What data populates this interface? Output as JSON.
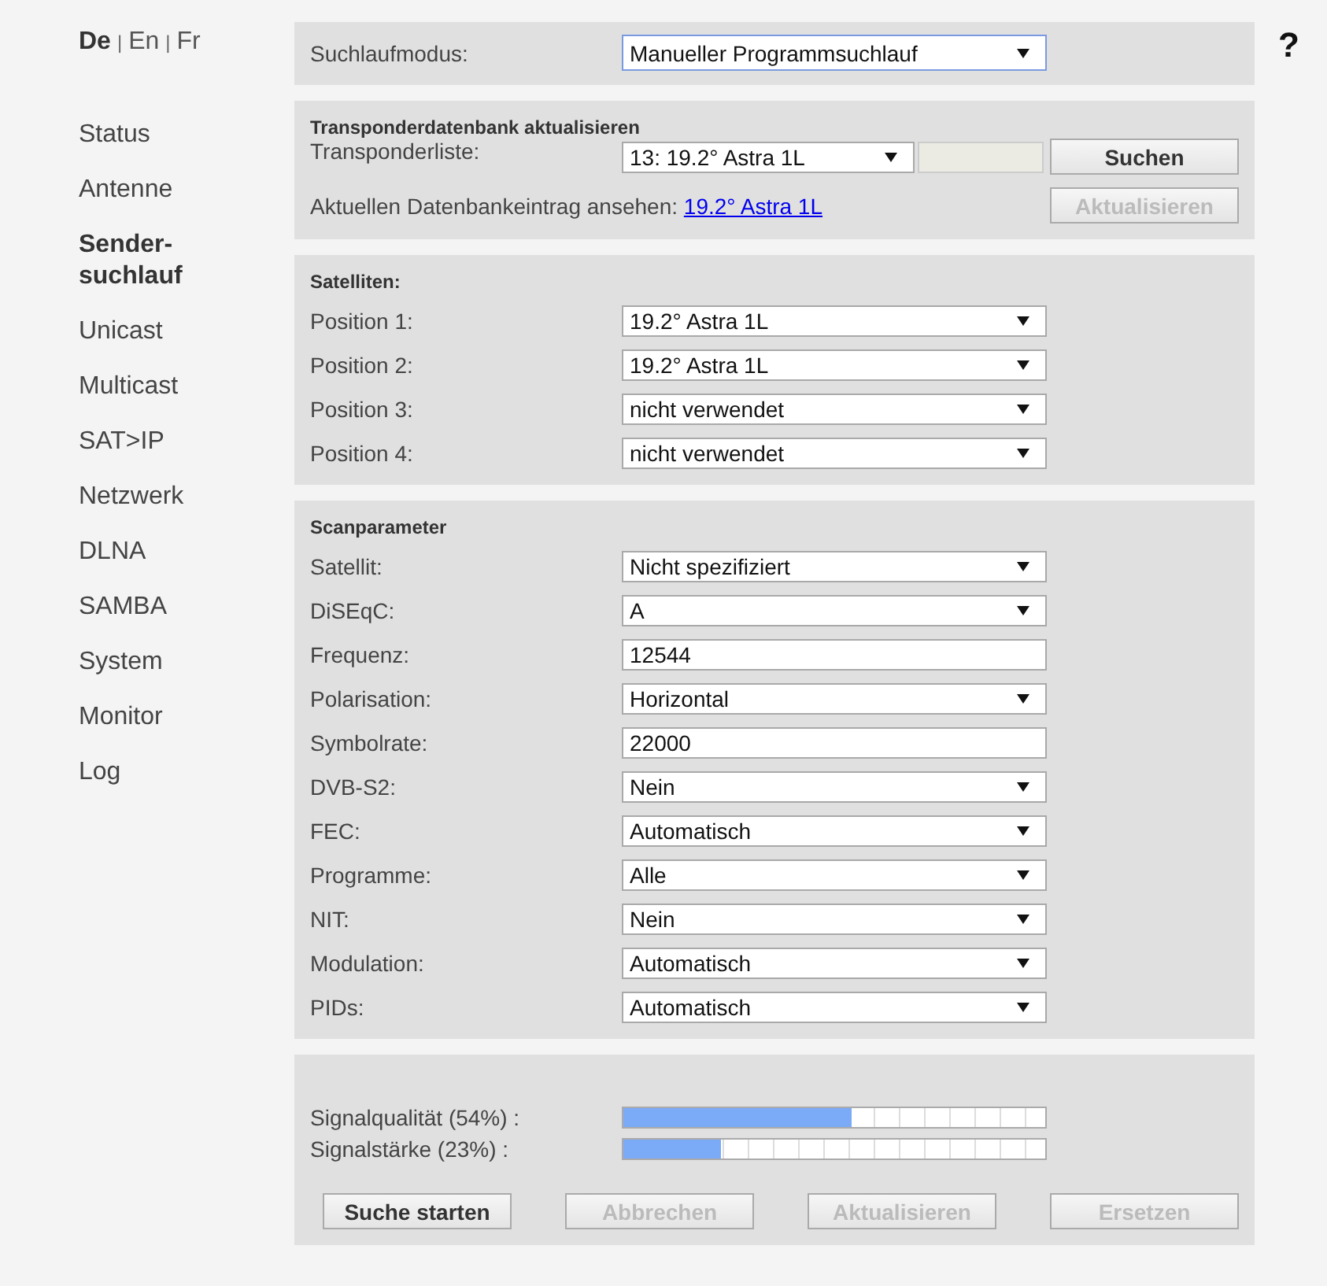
{
  "languages": [
    {
      "label": "De",
      "selected": true
    },
    {
      "label": "En",
      "selected": false
    },
    {
      "label": "Fr",
      "selected": false
    }
  ],
  "language_separator": "|",
  "help": "?",
  "sidebar": {
    "items": [
      {
        "label": "Status",
        "selected": false
      },
      {
        "label": "Antenne",
        "selected": false
      },
      {
        "label": "Sender-suchlauf",
        "selected": true
      },
      {
        "label": "Unicast",
        "selected": false
      },
      {
        "label": "Multicast",
        "selected": false
      },
      {
        "label": "SAT>IP",
        "selected": false
      },
      {
        "label": "Netzwerk",
        "selected": false
      },
      {
        "label": "DLNA",
        "selected": false
      },
      {
        "label": "SAMBA",
        "selected": false
      },
      {
        "label": "System",
        "selected": false
      },
      {
        "label": "Monitor",
        "selected": false
      },
      {
        "label": "Log",
        "selected": false
      }
    ]
  },
  "mode": {
    "label": "Suchlaufmodus:",
    "value": "Manueller Programmsuchlauf"
  },
  "transponder": {
    "title": "Transponderdatenbank aktualisieren",
    "label": "Transponderliste:",
    "value": "13: 19.2° Astra 1L",
    "search_button": {
      "label": "Suchen",
      "disabled": false
    },
    "entry_label": "Aktuellen Datenbankeintrag ansehen:",
    "entry_link": "19.2° Astra 1L",
    "update_button": {
      "label": "Aktualisieren",
      "disabled": true
    }
  },
  "satellites": {
    "title": "Satelliten:",
    "rows": [
      {
        "label": "Position 1:",
        "kind": "select",
        "value": "19.2° Astra 1L"
      },
      {
        "label": "Position 2:",
        "kind": "select",
        "value": "19.2° Astra 1L"
      },
      {
        "label": "Position 3:",
        "kind": "select",
        "value": "nicht verwendet"
      },
      {
        "label": "Position 4:",
        "kind": "select",
        "value": "nicht verwendet"
      }
    ]
  },
  "scan": {
    "title": "Scanparameter",
    "rows": [
      {
        "label": "Satellit:",
        "kind": "select",
        "value": "Nicht spezifiziert"
      },
      {
        "label": "DiSEqC:",
        "kind": "select",
        "value": "A"
      },
      {
        "label": "Frequenz:",
        "kind": "input",
        "value": "12544"
      },
      {
        "label": "Polarisation:",
        "kind": "select",
        "value": "Horizontal"
      },
      {
        "label": "Symbolrate:",
        "kind": "input",
        "value": "22000"
      },
      {
        "label": "DVB-S2:",
        "kind": "select",
        "value": "Nein"
      },
      {
        "label": "FEC:",
        "kind": "select",
        "value": "Automatisch"
      },
      {
        "label": "Programme:",
        "kind": "select",
        "value": "Alle"
      },
      {
        "label": "NIT:",
        "kind": "select",
        "value": "Nein"
      },
      {
        "label": "Modulation:",
        "kind": "select",
        "value": "Automatisch"
      },
      {
        "label": "PIDs:",
        "kind": "select",
        "value": "Automatisch"
      }
    ]
  },
  "signal": [
    {
      "label": "Signalqualität (54%) :",
      "level": 0.54
    },
    {
      "label": "Signalstärke (23%) :",
      "level": 0.23
    }
  ],
  "buttons": [
    {
      "label": "Suche starten",
      "disabled": false
    },
    {
      "label": "Abbrechen",
      "disabled": true
    },
    {
      "label": "Aktualisieren",
      "disabled": true
    },
    {
      "label": "Ersetzen",
      "disabled": true
    }
  ]
}
